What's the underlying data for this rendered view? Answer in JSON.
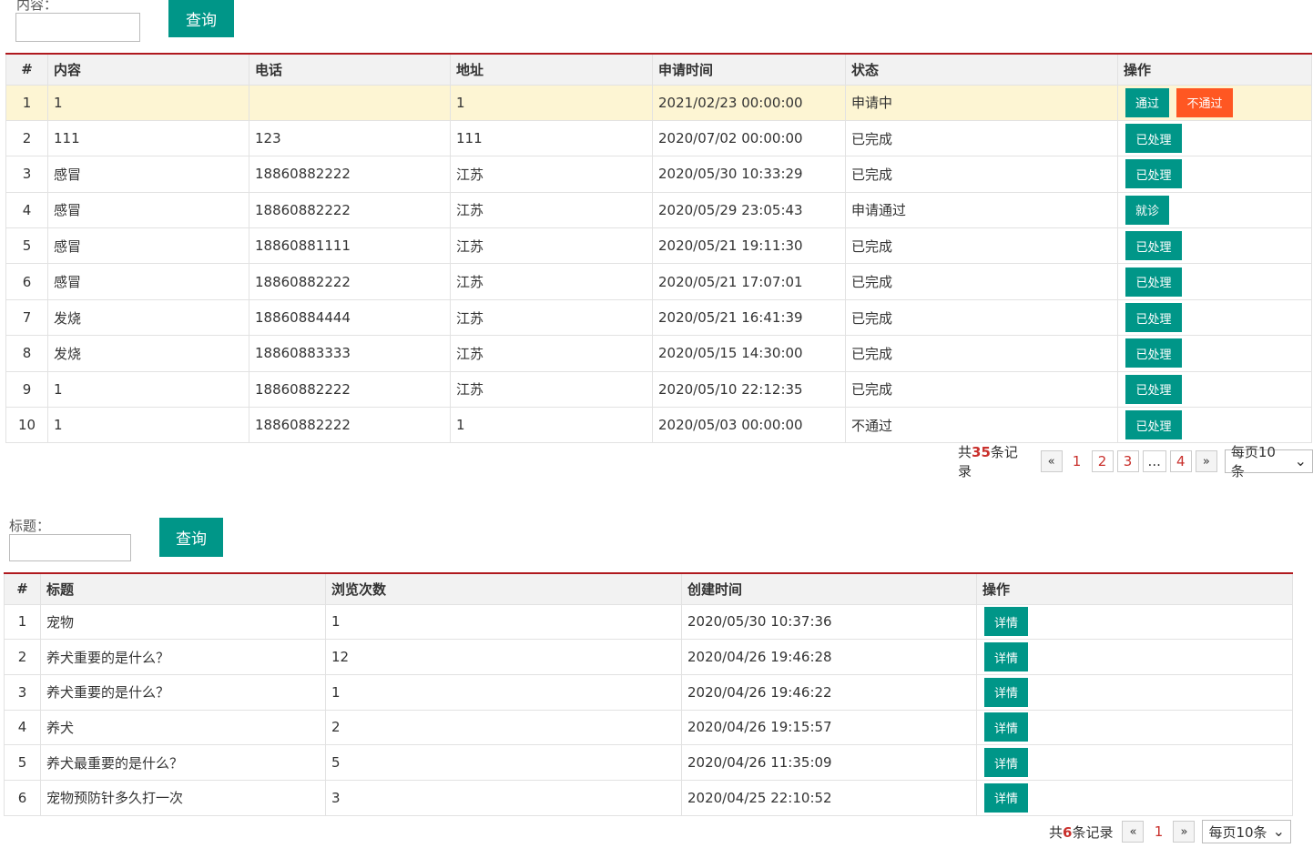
{
  "section1": {
    "search_label": "内容：",
    "query_label": "查询",
    "headers": [
      "#",
      "内容",
      "电话",
      "地址",
      "申请时间",
      "状态",
      "操作"
    ],
    "rows": [
      {
        "idx": "1",
        "content": "1",
        "phone": "",
        "address": "1",
        "time": "2021/02/23 00:00:00",
        "status": "申请中",
        "actions": [
          "通过",
          "不通过"
        ]
      },
      {
        "idx": "2",
        "content": "111",
        "phone": "123",
        "address": "111",
        "time": "2020/07/02 00:00:00",
        "status": "已完成",
        "actions": [
          "已处理"
        ]
      },
      {
        "idx": "3",
        "content": "感冒",
        "phone": "18860882222",
        "address": "江苏",
        "time": "2020/05/30 10:33:29",
        "status": "已完成",
        "actions": [
          "已处理"
        ]
      },
      {
        "idx": "4",
        "content": "感冒",
        "phone": "18860882222",
        "address": "江苏",
        "time": "2020/05/29 23:05:43",
        "status": "申请通过",
        "actions": [
          "就诊"
        ]
      },
      {
        "idx": "5",
        "content": "感冒",
        "phone": "18860881111",
        "address": "江苏",
        "time": "2020/05/21 19:11:30",
        "status": "已完成",
        "actions": [
          "已处理"
        ]
      },
      {
        "idx": "6",
        "content": "感冒",
        "phone": "18860882222",
        "address": "江苏",
        "time": "2020/05/21 17:07:01",
        "status": "已完成",
        "actions": [
          "已处理"
        ]
      },
      {
        "idx": "7",
        "content": "发烧",
        "phone": "18860884444",
        "address": "江苏",
        "time": "2020/05/21 16:41:39",
        "status": "已完成",
        "actions": [
          "已处理"
        ]
      },
      {
        "idx": "8",
        "content": "发烧",
        "phone": "18860883333",
        "address": "江苏",
        "time": "2020/05/15 14:30:00",
        "status": "已完成",
        "actions": [
          "已处理"
        ]
      },
      {
        "idx": "9",
        "content": "1",
        "phone": "18860882222",
        "address": "江苏",
        "time": "2020/05/10 22:12:35",
        "status": "已完成",
        "actions": [
          "已处理"
        ]
      },
      {
        "idx": "10",
        "content": "1",
        "phone": "18860882222",
        "address": "1",
        "time": "2020/05/03 00:00:00",
        "status": "不通过",
        "actions": [
          "已处理"
        ]
      }
    ],
    "pager": {
      "total_prefix": "共",
      "total_count": "35",
      "total_suffix": "条记录",
      "prev": "«",
      "pages": [
        "1",
        "2",
        "3",
        "...",
        "4"
      ],
      "next": "»",
      "per_page": "每页10条"
    }
  },
  "section2": {
    "search_label": "标题：",
    "query_label": "查询",
    "headers": [
      "#",
      "标题",
      "浏览次数",
      "创建时间",
      "操作"
    ],
    "rows": [
      {
        "idx": "1",
        "title": "宠物",
        "views": "1",
        "time": "2020/05/30 10:37:36",
        "action": "详情"
      },
      {
        "idx": "2",
        "title": "养犬重要的是什么？",
        "views": "12",
        "time": "2020/04/26 19:46:28",
        "action": "详情"
      },
      {
        "idx": "3",
        "title": "养犬重要的是什么？",
        "views": "1",
        "time": "2020/04/26 19:46:22",
        "action": "详情"
      },
      {
        "idx": "4",
        "title": "养犬",
        "views": "2",
        "time": "2020/04/26 19:15:57",
        "action": "详情"
      },
      {
        "idx": "5",
        "title": "养犬最重要的是什么？",
        "views": "5",
        "time": "2020/04/26 11:35:09",
        "action": "详情"
      },
      {
        "idx": "6",
        "title": "宠物预防针多久打一次",
        "views": "3",
        "time": "2020/04/25 22:10:52",
        "action": "详情"
      }
    ],
    "pager": {
      "total_prefix": "共",
      "total_count": "6",
      "total_suffix": "条记录",
      "prev": "«",
      "pages": [
        "1"
      ],
      "next": "»",
      "per_page": "每页10条"
    }
  },
  "icons": {
    "dropdown": "chevron-down-icon"
  },
  "colors": {
    "primary": "#009688",
    "danger": "#ff5722",
    "header_rule": "#b0191e",
    "highlight_row": "#fdf5d3",
    "count": "#c9302c"
  }
}
